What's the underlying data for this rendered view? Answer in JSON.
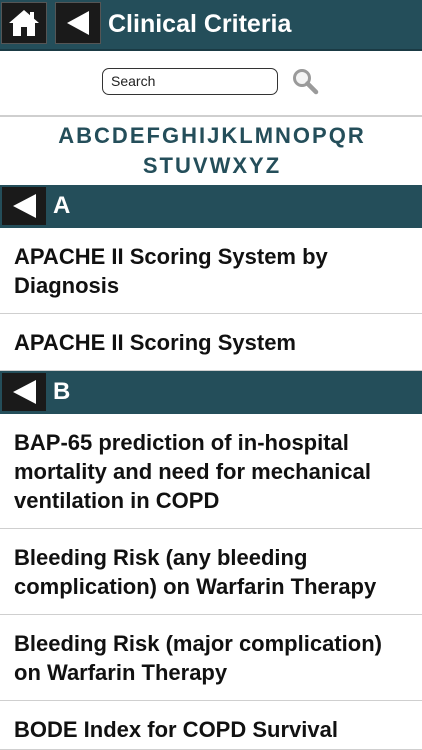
{
  "header": {
    "title": "Clinical Criteria",
    "home_icon": "home-icon",
    "back_icon": "back-arrow-icon"
  },
  "search": {
    "placeholder": "Search",
    "icon": "magnifier-icon"
  },
  "alphabet": {
    "row1": [
      "A",
      "B",
      "C",
      "D",
      "E",
      "F",
      "G",
      "H",
      "I",
      "J",
      "K",
      "L",
      "M",
      "N",
      "O",
      "P",
      "Q",
      "R"
    ],
    "row2": [
      "S",
      "T",
      "U",
      "V",
      "W",
      "X",
      "Y",
      "Z"
    ]
  },
  "sections": [
    {
      "letter": "A",
      "items": [
        "APACHE II Scoring System by Diagnosis",
        "APACHE II Scoring System"
      ]
    },
    {
      "letter": "B",
      "items": [
        "BAP-65 prediction of in-hospital mortality and need for mechanical ventilation in COPD",
        "Bleeding Risk (any bleeding complication) on Warfarin Therapy",
        "Bleeding Risk (major complication) on Warfarin Therapy",
        "BODE Index for COPD Survival Prediction"
      ]
    }
  ],
  "colors": {
    "header_bg": "#244e5a",
    "section_bg": "#244e5a",
    "button_bg": "#1a1a1a",
    "alphabet_text": "#244e5a"
  }
}
